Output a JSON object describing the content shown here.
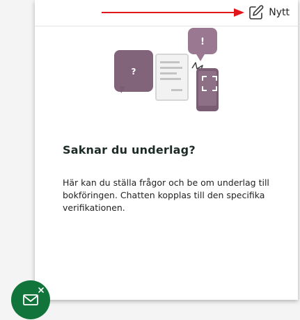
{
  "header": {
    "new_label": "Nytt",
    "new_icon": "edit-icon"
  },
  "empty_state": {
    "illustration_icon": "chat-document-phone-illustration",
    "title": "Saknar du underlag?",
    "description": "Här kan du ställa frågor och be om underlag till bokföringen. Chatten kopplas till den specifika verifikationen."
  },
  "fab": {
    "icon": "mail-close-icon"
  },
  "colors": {
    "accent_green": "#11743a",
    "bubble_purple": "#7a5c73",
    "annotation_arrow": "#e0161b"
  }
}
